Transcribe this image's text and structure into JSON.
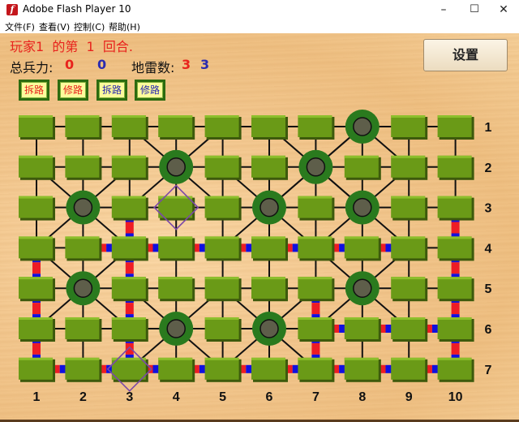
{
  "window": {
    "title": "Adobe Flash Player 10",
    "controls": {
      "minimize": "–",
      "maximize": "☐",
      "close": "✕"
    }
  },
  "menu": [
    "文件(F)",
    "查看(V)",
    "控制(C)",
    "帮助(H)"
  ],
  "status": {
    "turn_text": "玩家1  的第  1  回合.",
    "troops_label": "总兵力:",
    "troops_red": "0",
    "troops_blue": "0",
    "mines_label": "地雷数:",
    "mines_red": "3",
    "mines_blue": "3"
  },
  "tools": [
    {
      "label": "拆路",
      "color": "#e8231d"
    },
    {
      "label": "修路",
      "color": "#e8231d"
    },
    {
      "label": "拆路",
      "color": "#2b2bb0"
    },
    {
      "label": "修路",
      "color": "#2b2bb0"
    }
  ],
  "settings_label": "设置",
  "colors": {
    "tile": "#6a9a17",
    "camp_ring": "#2a7a1e",
    "camp_center": "#5e5e4a",
    "rail_red": "#ee1c24",
    "rail_blue": "#1010e0",
    "marker": "#7b48a8",
    "red_player": "#e8231d",
    "blue_player": "#2b2bb0"
  },
  "board": {
    "cols": 10,
    "rows": 7,
    "col_labels": [
      "1",
      "2",
      "3",
      "4",
      "5",
      "6",
      "7",
      "8",
      "9",
      "10"
    ],
    "row_labels": [
      "1",
      "2",
      "3",
      "4",
      "5",
      "6",
      "7"
    ],
    "camps": [
      [
        1,
        8
      ],
      [
        2,
        4
      ],
      [
        2,
        7
      ],
      [
        3,
        2
      ],
      [
        3,
        6
      ],
      [
        3,
        8
      ],
      [
        5,
        2
      ],
      [
        5,
        8
      ],
      [
        6,
        4
      ],
      [
        6,
        6
      ]
    ],
    "markers": [
      [
        3,
        4
      ],
      [
        7,
        3
      ]
    ],
    "rail_h": [
      [
        4,
        2
      ],
      [
        4,
        3
      ],
      [
        4,
        4
      ],
      [
        4,
        5
      ],
      [
        4,
        6
      ],
      [
        4,
        7
      ],
      [
        4,
        8
      ],
      [
        6,
        7
      ],
      [
        6,
        8
      ],
      [
        6,
        9
      ],
      [
        7,
        1
      ],
      [
        7,
        2
      ],
      [
        7,
        3
      ],
      [
        7,
        4
      ],
      [
        7,
        5
      ],
      [
        7,
        6
      ],
      [
        7,
        7
      ],
      [
        7,
        8
      ],
      [
        7,
        9
      ]
    ],
    "rail_v": [
      [
        4,
        1
      ],
      [
        5,
        1
      ],
      [
        6,
        1
      ],
      [
        3,
        3
      ],
      [
        4,
        3
      ],
      [
        5,
        3
      ],
      [
        6,
        3
      ],
      [
        5,
        7
      ],
      [
        6,
        7
      ],
      [
        3,
        10
      ],
      [
        4,
        10
      ],
      [
        5,
        10
      ],
      [
        6,
        10
      ]
    ]
  }
}
